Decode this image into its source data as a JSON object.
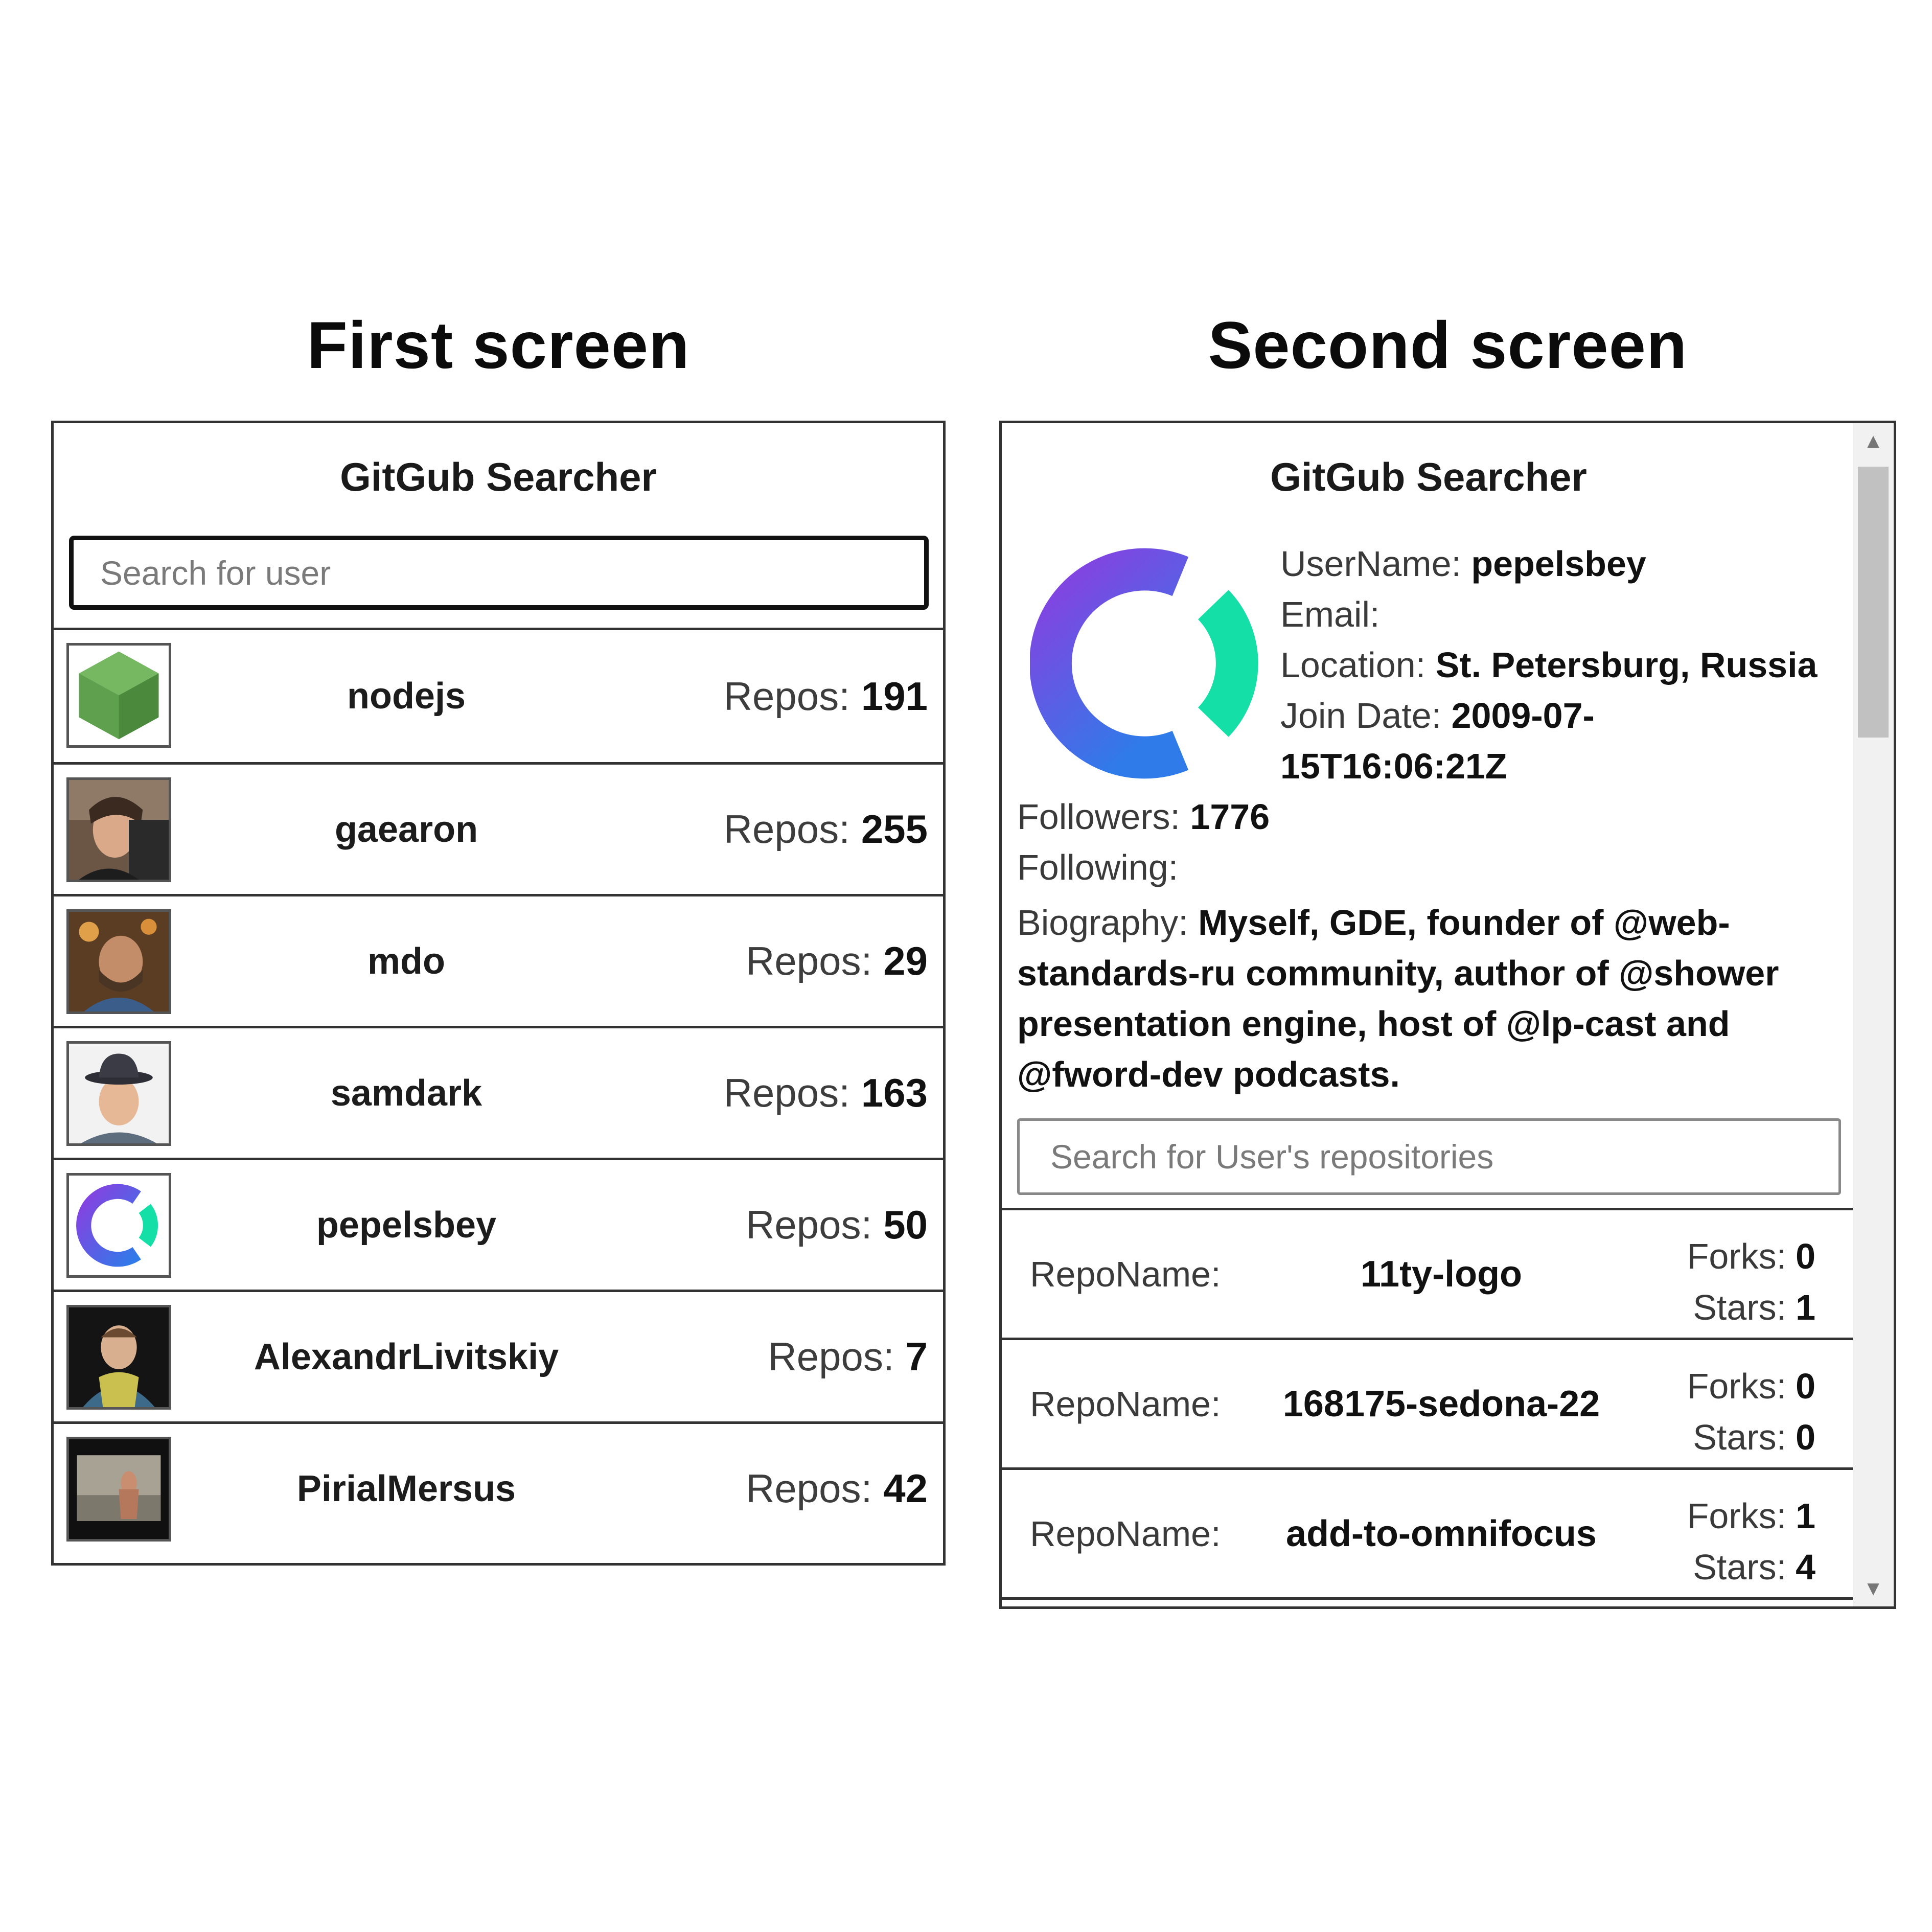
{
  "headings": {
    "first": "First screen",
    "second": "Second screen"
  },
  "first_screen": {
    "title": "GitGub Searcher",
    "search_placeholder": "Search for user",
    "repos_label": "Repos:",
    "users": [
      {
        "login": "nodejs",
        "repos": "191",
        "avatar": "nodejs-hexagon-avatar"
      },
      {
        "login": "gaearon",
        "repos": "255",
        "avatar": "portrait-photo-avatar"
      },
      {
        "login": "mdo",
        "repos": "29",
        "avatar": "portrait-photo-avatar"
      },
      {
        "login": "samdark",
        "repos": "163",
        "avatar": "portrait-photo-avatar"
      },
      {
        "login": "pepelsbey",
        "repos": "50",
        "avatar": "ring-logo-avatar"
      },
      {
        "login": "AlexandrLivitskiy",
        "repos": "7",
        "avatar": "portrait-photo-avatar"
      },
      {
        "login": "PirialMersus",
        "repos": "42",
        "avatar": "photo-avatar"
      }
    ]
  },
  "second_screen": {
    "title": "GitGub Searcher",
    "profile": {
      "username_label": "UserName:",
      "username": "pepelsbey",
      "email_label": "Email:",
      "email": "",
      "location_label": "Location:",
      "location": "St. Petersburg, Russia",
      "join_label": "Join Date:",
      "join_line1": "2009-07-",
      "join_line2": "15T16:06:21Z",
      "followers_label": "Followers:",
      "followers": "1776",
      "following_label": "Following:",
      "following": "",
      "bio_label": "Biography:",
      "bio": "Myself, GDE, founder of @web-standards-ru community, author of @shower presentation engine, host of @lp-cast and @fword-dev podcasts."
    },
    "repo_search_placeholder": "Search for User's repositories",
    "repo_label": "RepoName:",
    "forks_label": "Forks:",
    "stars_label": "Stars:",
    "repos": [
      {
        "name": "11ty-logo",
        "forks": "0",
        "stars": "1"
      },
      {
        "name": "168175-sedona-22",
        "forks": "0",
        "stars": "0"
      },
      {
        "name": "add-to-omnifocus",
        "forks": "1",
        "stars": "4"
      }
    ],
    "scroll_up_icon": "▲",
    "scroll_down_icon": "▼"
  },
  "colors": {
    "ring_purple": "#7a3fe4",
    "ring_blue": "#3f6fea",
    "ring_teal": "#13dfa6",
    "node_green": "#5fa04e"
  }
}
